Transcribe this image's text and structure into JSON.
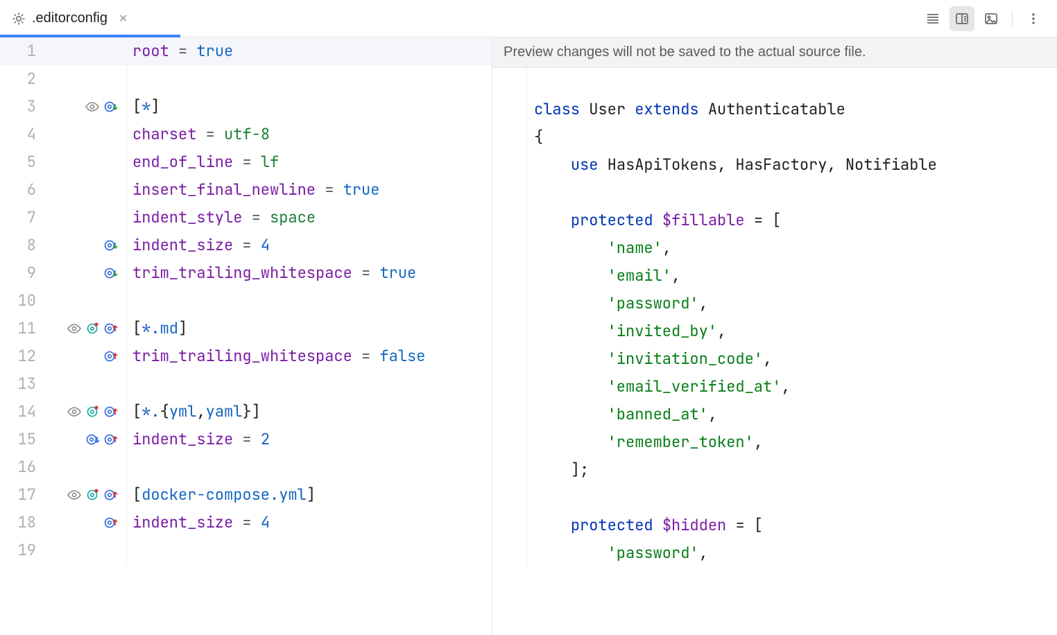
{
  "tab": {
    "title": ".editorconfig"
  },
  "toolbar": {
    "icons": {
      "soft_wrap": "soft-wrap-icon",
      "preview": "preview-panel-icon",
      "image": "image-icon",
      "more": "more-icon"
    }
  },
  "preview": {
    "banner": "Preview changes will not be saved to the actual source file."
  },
  "editor": {
    "lines": [
      {
        "n": 1,
        "current": true,
        "icons": [],
        "tokens": [
          [
            "c-key",
            "root"
          ],
          [
            "",
            " "
          ],
          [
            "c-eq",
            "="
          ],
          [
            "",
            " "
          ],
          [
            "c-true",
            "true"
          ]
        ]
      },
      {
        "n": 2,
        "icons": [],
        "tokens": [
          [
            "",
            ""
          ]
        ]
      },
      {
        "n": 3,
        "icons": [
          "eye",
          "at-down"
        ],
        "tokens": [
          [
            "c-br",
            "["
          ],
          [
            "c-sect",
            "*"
          ],
          [
            "c-br",
            "]"
          ]
        ]
      },
      {
        "n": 4,
        "icons": [],
        "tokens": [
          [
            "c-key",
            "charset"
          ],
          [
            "",
            " "
          ],
          [
            "c-eq",
            "="
          ],
          [
            "",
            " "
          ],
          [
            "c-val",
            "utf-8"
          ]
        ]
      },
      {
        "n": 5,
        "icons": [],
        "tokens": [
          [
            "c-key",
            "end_of_line"
          ],
          [
            "",
            " "
          ],
          [
            "c-eq",
            "="
          ],
          [
            "",
            " "
          ],
          [
            "c-val",
            "lf"
          ]
        ]
      },
      {
        "n": 6,
        "icons": [],
        "tokens": [
          [
            "c-key",
            "insert_final_newline"
          ],
          [
            "",
            " "
          ],
          [
            "c-eq",
            "="
          ],
          [
            "",
            " "
          ],
          [
            "c-true",
            "true"
          ]
        ]
      },
      {
        "n": 7,
        "icons": [],
        "tokens": [
          [
            "c-key",
            "indent_style"
          ],
          [
            "",
            " "
          ],
          [
            "c-eq",
            "="
          ],
          [
            "",
            " "
          ],
          [
            "c-val",
            "space"
          ]
        ]
      },
      {
        "n": 8,
        "icons": [
          "at-down"
        ],
        "tokens": [
          [
            "c-key",
            "indent_size"
          ],
          [
            "",
            " "
          ],
          [
            "c-eq",
            "="
          ],
          [
            "",
            " "
          ],
          [
            "c-num",
            "4"
          ]
        ]
      },
      {
        "n": 9,
        "icons": [
          "at-down"
        ],
        "tokens": [
          [
            "c-key",
            "trim_trailing_whitespace"
          ],
          [
            "",
            " "
          ],
          [
            "c-eq",
            "="
          ],
          [
            "",
            " "
          ],
          [
            "c-true",
            "true"
          ]
        ]
      },
      {
        "n": 10,
        "icons": [],
        "tokens": [
          [
            "",
            ""
          ]
        ]
      },
      {
        "n": 11,
        "icons": [
          "eye",
          "target-dot",
          "at-up"
        ],
        "tokens": [
          [
            "c-br",
            "["
          ],
          [
            "c-sect",
            "*"
          ],
          [
            "c-id",
            ".md"
          ],
          [
            "c-br",
            "]"
          ]
        ]
      },
      {
        "n": 12,
        "icons": [
          "at-up"
        ],
        "tokens": [
          [
            "c-key",
            "trim_trailing_whitespace"
          ],
          [
            "",
            " "
          ],
          [
            "c-eq",
            "="
          ],
          [
            "",
            " "
          ],
          [
            "c-true",
            "false"
          ]
        ]
      },
      {
        "n": 13,
        "icons": [],
        "tokens": [
          [
            "",
            ""
          ]
        ]
      },
      {
        "n": 14,
        "icons": [
          "eye",
          "target-dot",
          "at-up"
        ],
        "tokens": [
          [
            "c-br",
            "["
          ],
          [
            "c-sect",
            "*"
          ],
          [
            "c-id",
            "."
          ],
          [
            "c-br",
            "{"
          ],
          [
            "c-id",
            "yml"
          ],
          [
            "c-br",
            ","
          ],
          [
            "c-id",
            "yaml"
          ],
          [
            "c-br",
            "}"
          ],
          [
            "c-br",
            "]"
          ]
        ]
      },
      {
        "n": 15,
        "icons": [
          "at-down-blue",
          "at-up"
        ],
        "tokens": [
          [
            "c-key",
            "indent_size"
          ],
          [
            "",
            " "
          ],
          [
            "c-eq",
            "="
          ],
          [
            "",
            " "
          ],
          [
            "c-num",
            "2"
          ]
        ]
      },
      {
        "n": 16,
        "icons": [],
        "tokens": [
          [
            "",
            ""
          ]
        ]
      },
      {
        "n": 17,
        "icons": [
          "eye",
          "target-dot",
          "at-up"
        ],
        "tokens": [
          [
            "c-br",
            "["
          ],
          [
            "c-id",
            "docker-compose.yml"
          ],
          [
            "c-br",
            "]"
          ]
        ]
      },
      {
        "n": 18,
        "icons": [
          "at-up"
        ],
        "tokens": [
          [
            "c-key",
            "indent_size"
          ],
          [
            "",
            " "
          ],
          [
            "c-eq",
            "="
          ],
          [
            "",
            " "
          ],
          [
            "c-num",
            "4"
          ]
        ]
      },
      {
        "n": 19,
        "icons": [],
        "tokens": [
          [
            "",
            ""
          ]
        ]
      }
    ]
  },
  "previewCode": {
    "lines": [
      {
        "tokens": [
          [
            "",
            ""
          ]
        ]
      },
      {
        "tokens": [
          [
            "tok-kw",
            "class"
          ],
          [
            "",
            " "
          ],
          [
            "tok-name",
            "User"
          ],
          [
            "",
            " "
          ],
          [
            "tok-kw",
            "extends"
          ],
          [
            "",
            " "
          ],
          [
            "tok-name",
            "Authenticatable"
          ]
        ]
      },
      {
        "tokens": [
          [
            "tok-punc",
            "{"
          ]
        ]
      },
      {
        "tokens": [
          [
            "",
            "    "
          ],
          [
            "tok-kw",
            "use"
          ],
          [
            "",
            " "
          ],
          [
            "tok-name",
            "HasApiTokens, HasFactory, Notifiable"
          ]
        ]
      },
      {
        "tokens": [
          [
            "",
            ""
          ]
        ]
      },
      {
        "tokens": [
          [
            "",
            "    "
          ],
          [
            "tok-kw",
            "protected"
          ],
          [
            "",
            " "
          ],
          [
            "tok-var",
            "$fillable"
          ],
          [
            "",
            " "
          ],
          [
            "tok-punc",
            "="
          ],
          [
            "",
            " "
          ],
          [
            "tok-punc",
            "["
          ]
        ]
      },
      {
        "tokens": [
          [
            "",
            "        "
          ],
          [
            "tok-str",
            "'name'"
          ],
          [
            "tok-punc",
            ","
          ]
        ]
      },
      {
        "tokens": [
          [
            "",
            "        "
          ],
          [
            "tok-str",
            "'email'"
          ],
          [
            "tok-punc",
            ","
          ]
        ]
      },
      {
        "tokens": [
          [
            "",
            "        "
          ],
          [
            "tok-str",
            "'password'"
          ],
          [
            "tok-punc",
            ","
          ]
        ]
      },
      {
        "tokens": [
          [
            "",
            "        "
          ],
          [
            "tok-str",
            "'invited_by'"
          ],
          [
            "tok-punc",
            ","
          ]
        ]
      },
      {
        "tokens": [
          [
            "",
            "        "
          ],
          [
            "tok-str",
            "'invitation_code'"
          ],
          [
            "tok-punc",
            ","
          ]
        ]
      },
      {
        "tokens": [
          [
            "",
            "        "
          ],
          [
            "tok-str",
            "'email_verified_at'"
          ],
          [
            "tok-punc",
            ","
          ]
        ]
      },
      {
        "tokens": [
          [
            "",
            "        "
          ],
          [
            "tok-str",
            "'banned_at'"
          ],
          [
            "tok-punc",
            ","
          ]
        ]
      },
      {
        "tokens": [
          [
            "",
            "        "
          ],
          [
            "tok-str",
            "'remember_token'"
          ],
          [
            "tok-punc",
            ","
          ]
        ]
      },
      {
        "tokens": [
          [
            "",
            "    "
          ],
          [
            "tok-punc",
            "];"
          ]
        ]
      },
      {
        "tokens": [
          [
            "",
            ""
          ]
        ]
      },
      {
        "tokens": [
          [
            "",
            "    "
          ],
          [
            "tok-kw",
            "protected"
          ],
          [
            "",
            " "
          ],
          [
            "tok-var",
            "$hidden"
          ],
          [
            "",
            " "
          ],
          [
            "tok-punc",
            "="
          ],
          [
            "",
            " "
          ],
          [
            "tok-punc",
            "["
          ]
        ]
      },
      {
        "tokens": [
          [
            "",
            "        "
          ],
          [
            "tok-str",
            "'password'"
          ],
          [
            "tok-punc",
            ","
          ]
        ]
      }
    ]
  }
}
